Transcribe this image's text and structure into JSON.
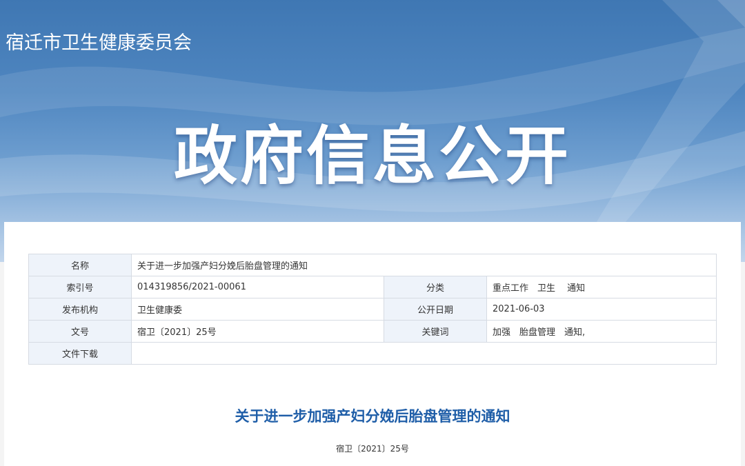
{
  "header": {
    "org_name": "宿迁市卫生健康委员会",
    "hero_title": "政府信息公开"
  },
  "meta_table": {
    "name_label": "名称",
    "name_value": "关于进一步加强产妇分娩后胎盘管理的通知",
    "index_label": "索引号",
    "index_value": "014319856/2021-00061",
    "category_label": "分类",
    "category_value": "重点工作　卫生　 通知",
    "publisher_label": "发布机构",
    "publisher_value": "卫生健康委",
    "date_label": "公开日期",
    "date_value": "2021-06-03",
    "docno_label": "文号",
    "docno_value": "宿卫〔2021〕25号",
    "keywords_label": "关键词",
    "keywords_value": "加强　胎盘管理　通知,",
    "download_label": "文件下载",
    "download_value": ""
  },
  "document": {
    "title": "关于进一步加强产妇分娩后胎盘管理的通知",
    "doc_number": "宿卫〔2021〕25号"
  },
  "colors": {
    "banner_top": "#3f77b3",
    "title_blue": "#1f5ea8",
    "label_bg": "#eef3fa",
    "border": "#d6dbe3"
  }
}
